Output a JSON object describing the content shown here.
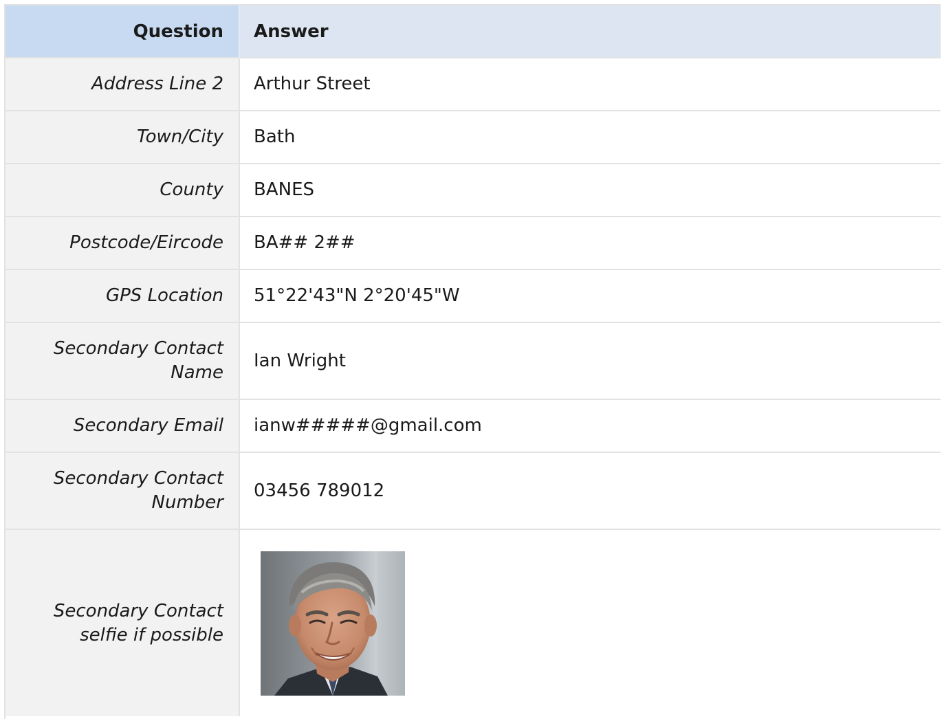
{
  "header": {
    "question": "Question",
    "answer": "Answer"
  },
  "rows": [
    {
      "question": "Address Line 2",
      "answer": "Arthur Street"
    },
    {
      "question": "Town/City",
      "answer": "Bath"
    },
    {
      "question": "County",
      "answer": "BANES"
    },
    {
      "question": "Postcode/Eircode",
      "answer": "BA## 2##"
    },
    {
      "question": "GPS Location",
      "answer": "51°22'43\"N 2°20'45\"W"
    },
    {
      "question": "Secondary Contact Name",
      "answer": "Ian Wright"
    },
    {
      "question": "Secondary Email",
      "answer": "ianw#####@gmail.com"
    },
    {
      "question": "Secondary Contact Number",
      "answer": "03456 789012"
    },
    {
      "question": "Secondary Contact selfie if possible",
      "answer_icon": "person-photo"
    }
  ]
}
